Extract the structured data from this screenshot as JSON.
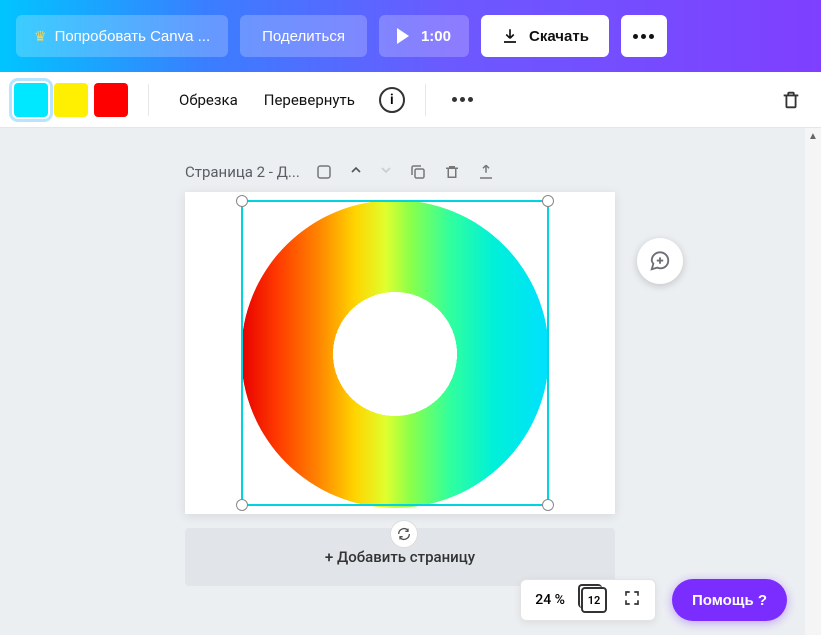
{
  "topbar": {
    "try_label": "Попробовать Canva ...",
    "share_label": "Поделиться",
    "duration": "1:00",
    "download_label": "Скачать"
  },
  "toolbar": {
    "swatches": [
      "#00e8ff",
      "#ffef00",
      "#ff0000"
    ],
    "crop_label": "Обрезка",
    "flip_label": "Перевернуть"
  },
  "page": {
    "header_label": "Страница 2 - Д..."
  },
  "add_page_label": "+ Добавить страницу",
  "footer": {
    "zoom": "24 %",
    "page_count": "12",
    "help_label": "Помощь ?"
  }
}
